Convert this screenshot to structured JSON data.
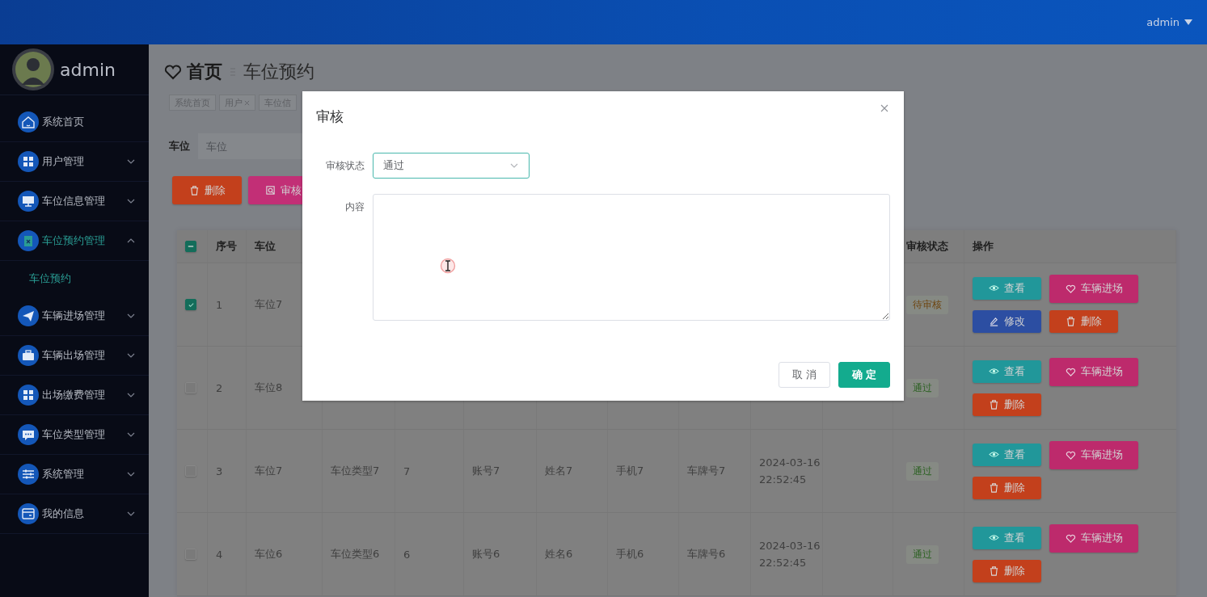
{
  "topbar": {
    "user": "admin"
  },
  "sidebar": {
    "user": "admin",
    "menu": [
      {
        "kind": "link",
        "label": "系统首页",
        "selected": false
      },
      {
        "kind": "group",
        "label": "用户管理",
        "selected": false,
        "expanded": false
      },
      {
        "kind": "group",
        "label": "车位信息管理",
        "selected": false,
        "expanded": false
      },
      {
        "kind": "group",
        "label": "车位预约管理",
        "selected": true,
        "expanded": true,
        "children": [
          {
            "label": "车位预约",
            "selected": true
          }
        ]
      },
      {
        "kind": "group",
        "label": "车辆进场管理",
        "selected": false,
        "expanded": false
      },
      {
        "kind": "group",
        "label": "车辆出场管理",
        "selected": false,
        "expanded": false
      },
      {
        "kind": "group",
        "label": "出场缴费管理",
        "selected": false,
        "expanded": false
      },
      {
        "kind": "group",
        "label": "车位类型管理",
        "selected": false,
        "expanded": false
      },
      {
        "kind": "group",
        "label": "系统管理",
        "selected": false,
        "expanded": false
      },
      {
        "kind": "group",
        "label": "我的信息",
        "selected": false,
        "expanded": false
      }
    ]
  },
  "breadcrumb": {
    "home": "首页",
    "current": "车位预约"
  },
  "tags": [
    {
      "label": "系统首页",
      "closable": false
    },
    {
      "label": "用户",
      "closable": true
    },
    {
      "label": "车位信",
      "closable": false
    }
  ],
  "search": {
    "label": "车位",
    "placeholder": "车位"
  },
  "toolbar": [
    {
      "kind": "delete",
      "label": "删除"
    },
    {
      "kind": "audit",
      "label": "审核"
    }
  ],
  "table": {
    "header_checkbox": {
      "indeterminate": true
    },
    "columns": [
      "序号",
      "车位",
      "审核状态",
      "操作"
    ],
    "rows": [
      {
        "checked": true,
        "index": "1",
        "space": "车位7",
        "status": "待审核",
        "color": "#6e4510",
        "actions": [
          {
            "kind": "view",
            "label": "查看"
          },
          {
            "kind": "enter",
            "label": "车辆进场"
          },
          {
            "kind": "edit",
            "label": "修改"
          },
          {
            "kind": "delete",
            "label": "删除"
          }
        ]
      },
      {
        "checked": false,
        "index": "2",
        "space": "车位8",
        "status": "通过",
        "color": "#2a6020",
        "actions": [
          {
            "kind": "view",
            "label": "查看"
          },
          {
            "kind": "enter",
            "label": "车辆进场"
          },
          {
            "kind": "delete",
            "label": "删除"
          }
        ]
      },
      {
        "checked": false,
        "index": "3",
        "space": "车位7",
        "type": "车位类型7",
        "number": "7",
        "account": "账号7",
        "name": "姓名7",
        "phone": "手机7",
        "plate": "车牌号7",
        "date": "2024-03-16",
        "time": "22:52:45",
        "status": "通过",
        "color": "#2a6020",
        "actions": [
          {
            "kind": "view",
            "label": "查看"
          },
          {
            "kind": "enter",
            "label": "车辆进场"
          },
          {
            "kind": "delete",
            "label": "删除"
          }
        ]
      },
      {
        "checked": false,
        "index": "4",
        "space": "车位6",
        "type": "车位类型6",
        "number": "6",
        "account": "账号6",
        "name": "姓名6",
        "phone": "手机6",
        "plate": "车牌号6",
        "date": "2024-03-16",
        "time": "22:52:45",
        "status": "通过",
        "color": "#2a6020",
        "actions": [
          {
            "kind": "view",
            "label": "查看"
          },
          {
            "kind": "enter",
            "label": "车辆进场"
          },
          {
            "kind": "delete",
            "label": "删除"
          }
        ]
      }
    ]
  },
  "dialog": {
    "title": "审核",
    "fields": [
      {
        "kind": "select",
        "label": "审核状态",
        "value": "通过",
        "focused": true
      },
      {
        "kind": "textarea",
        "label": "内容",
        "focused": false
      }
    ],
    "buttons": [
      {
        "kind": "cancel",
        "label": "取 消"
      },
      {
        "kind": "primary",
        "label": "确 定"
      }
    ]
  }
}
